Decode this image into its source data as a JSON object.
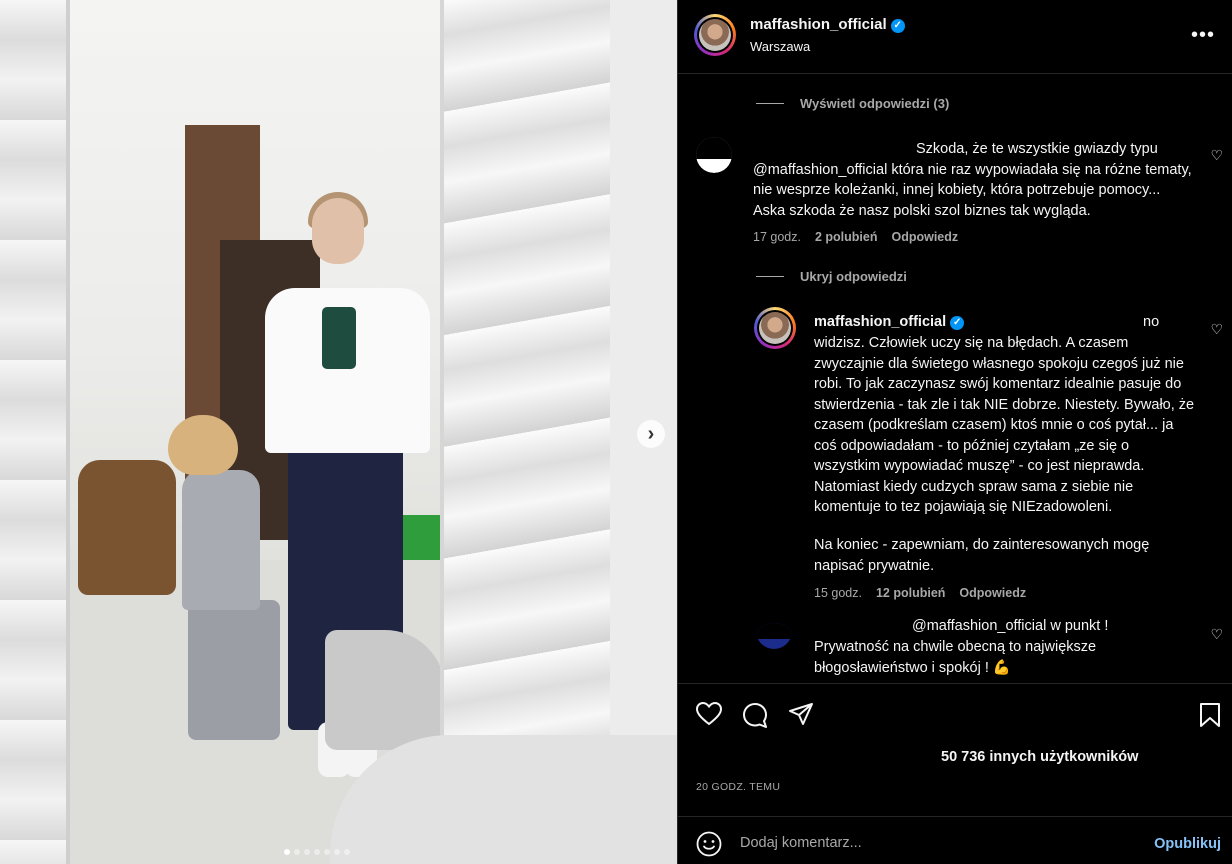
{
  "post": {
    "username": "maffashion_official",
    "location": "Warszawa",
    "verified_icon": "check-badge-icon",
    "more_icon": "•••",
    "carousel": {
      "slide_count": 7,
      "active_index": 0,
      "next_icon": "›"
    }
  },
  "comments": {
    "view_replies_label": "Wyświetl odpowiedzi (3)",
    "hide_replies_label": "Ukryj odpowiedzi",
    "items": [
      {
        "text": "Szkoda, że te wszystkie gwiazdy typu @maffashion_official która nie raz wypowiadała się na różne tematy, nie wesprze koleżanki, innej kobiety, która potrzebuje pomocy... Aska szkoda że nasz polski szol biznes tak wygląda.",
        "time": "17 godz.",
        "likes": "2 polubień",
        "reply": "Odpowiedz"
      },
      {
        "username": "maffashion_official",
        "text_first": "no",
        "text": "widzisz. Człowiek uczy się na błędach. A czasem zwyczajnie dla świetego własnego spokoju czegoś już nie robi. To jak zaczynasz swój komentarz idealnie pasuje do stwierdzenia - tak zle i tak NIE dobrze. Niestety. Bywało, że czasem (podkreślam czasem) ktoś mnie o coś pytał... ja coś odpowiadałam - to później czytałam „ze się o wszystkim wypowiadać muszę” - co jest nieprawda. Natomiast kiedy cudzych spraw sama z siebie nie komentuje to tez pojawiają się NIEzadowoleni.",
        "text_end": "Na koniec - zapewniam, do zainteresowanych mogę napisać prywatnie.",
        "time": "15 godz.",
        "likes": "12 polubień",
        "reply": "Odpowiedz"
      },
      {
        "text_first": "@maffashion_official w punkt !",
        "text": "Prywatność na chwile obecną to największe błogosławieństwo i spokój ! 💪"
      }
    ]
  },
  "actions": {
    "likes_text": "50 736 innych użytkowników",
    "timestamp": "20 GODZ. TEMU"
  },
  "add_comment": {
    "placeholder": "Dodaj komentarz...",
    "publish_label": "Opublikuj"
  },
  "colors": {
    "background": "#000000",
    "text": "#f5f5f5",
    "secondary": "#a8a8a8",
    "divider": "#262626",
    "verified": "#0095f6",
    "publish": "#85c1f5"
  }
}
